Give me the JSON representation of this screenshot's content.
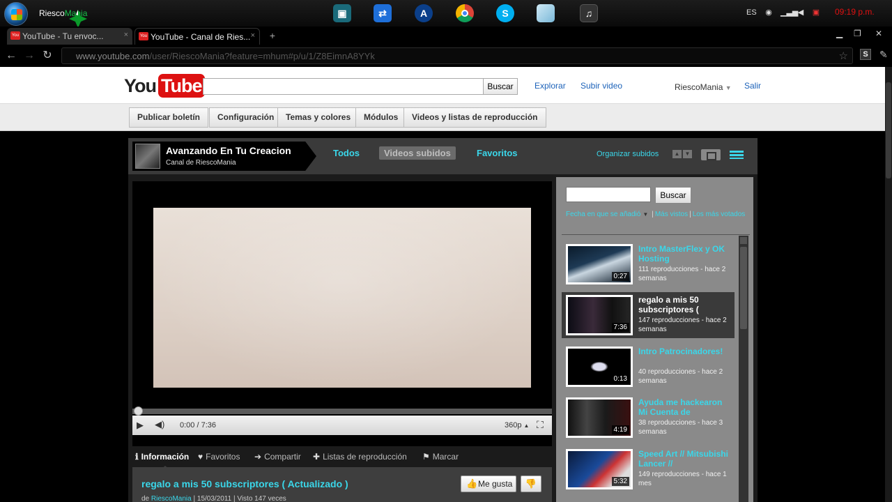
{
  "taskbar": {
    "username": "RiescoMania",
    "username_prefix": "Riesco",
    "username_suffix": "Mania",
    "lang": "ES",
    "time": "09:19 p.m.",
    "apps": [
      "film-app",
      "teamviewer-app",
      "arduino-app",
      "chrome-app",
      "skype-app",
      "notes-app",
      "media-app"
    ]
  },
  "browser": {
    "tabs": [
      {
        "title": "YouTube - Tu envoc...",
        "active": false
      },
      {
        "title": "YouTube - Canal de Ries...",
        "active": true
      }
    ],
    "url_host": "www.youtube.com",
    "url_path": "/user/RiescoMania?feature=mhum#p/u/1/Z8EimnA8YYk"
  },
  "header": {
    "logo_you": "You",
    "logo_tube": "Tube",
    "search_placeholder": "",
    "search_button": "Buscar",
    "links": [
      "Explorar",
      "Subir video"
    ],
    "user": "RiescoMania",
    "logout": "Salir"
  },
  "subnav": [
    "Publicar boletín",
    "Configuración",
    "Temas y colores",
    "Módulos",
    "Videos y listas de reproducción"
  ],
  "channel": {
    "title": "Avanzando En Tu Creacion",
    "subtitle": "Canal de RiescoMania",
    "tabs": [
      "Todos",
      "Videos subidos",
      "Favoritos"
    ],
    "active_tab": "Videos subidos",
    "organize_link": "Organizar subidos"
  },
  "player": {
    "time": "0:00 / 7:36",
    "quality": "360p",
    "progress": 0
  },
  "actions": [
    {
      "icon": "info-icon",
      "glyph": "ℹ",
      "label": "Información"
    },
    {
      "icon": "heart-icon",
      "glyph": "♥",
      "label": "Favoritos"
    },
    {
      "icon": "share-arrow-icon",
      "glyph": "➔",
      "label": "Compartir"
    },
    {
      "icon": "plus-icon",
      "glyph": "✚",
      "label": "Listas de reproducción"
    },
    {
      "icon": "flag-icon",
      "glyph": "⚑",
      "label": "Marcar"
    }
  ],
  "video": {
    "title": "regalo a mis 50 subscriptores ( Actualizado )",
    "by": "de",
    "author": "RiescoMania",
    "date": "| 15/03/2011",
    "views": "| Visto 147 veces",
    "like_label": "Me gusta"
  },
  "sidebar": {
    "search_button": "Buscar",
    "sort_date": "Fecha en que se añadió",
    "sort_viewed": "Más vistos",
    "sort_rated": "Los más votados",
    "videos": [
      {
        "title": "Intro MasterFlex y OK Hosting",
        "meta": "111 reproducciones - hace 2 semanas",
        "duration": "0:27",
        "active": false
      },
      {
        "title": "regalo a mis 50 subscriptores (",
        "meta": "147 reproducciones - hace 2 semanas",
        "duration": "7:36",
        "active": true
      },
      {
        "title": "Intro Patrocinadores!",
        "meta": "40 reproducciones - hace 2 semanas",
        "duration": "0:13",
        "active": false
      },
      {
        "title": "Ayuda me hackearon Mi Cuenta de",
        "meta": "38 reproducciones - hace 3 semanas",
        "duration": "4:19",
        "active": false
      },
      {
        "title": "Speed Art // Mitsubishi Lancer //",
        "meta": "149 reproducciones - hace 1 mes",
        "duration": "5:32",
        "active": false
      }
    ]
  }
}
